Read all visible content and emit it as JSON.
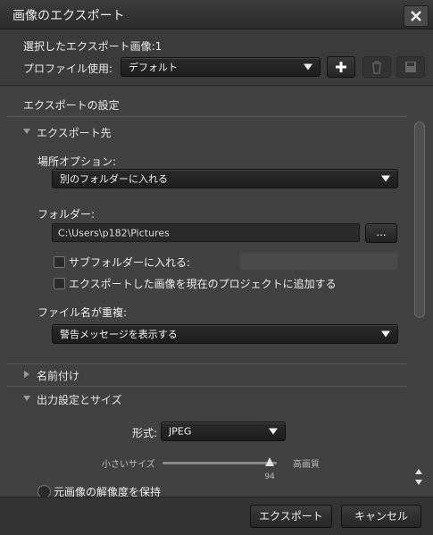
{
  "window": {
    "title": "画像のエクスポート"
  },
  "header": {
    "selected_count": "選択したエクスポート画像:1",
    "profile_label": "プロファイル使用:",
    "profile_value": "デフォルト"
  },
  "settings": {
    "heading": "エクスポートの設定",
    "export_dest": {
      "title": "エクスポート先",
      "location_label": "場所オプション:",
      "location_value": "別のフォルダーに入れる",
      "folder_label": "フォルダー:",
      "folder_value": "C:\\Users\\p182\\Pictures",
      "browse_label": "...",
      "subfolder_label": "サブフォルダーに入れる:",
      "add_to_project_label": "エクスポートした画像を現在のプロジェクトに追加する",
      "duplicate_label": "ファイル名が重複:",
      "duplicate_value": "警告メッセージを表示する"
    },
    "naming": {
      "title": "名前付け"
    },
    "output": {
      "title": "出力設定とサイズ",
      "format_label": "形式:",
      "format_value": "JPEG",
      "quality_low": "小さいサイズ",
      "quality_high": "高画質",
      "quality_value": "94",
      "quality_fraction": 0.94,
      "keep_resolution": "元画像の解像度を保持"
    }
  },
  "footer": {
    "export_button": "エクスポート",
    "cancel_button": "キャンセル"
  }
}
